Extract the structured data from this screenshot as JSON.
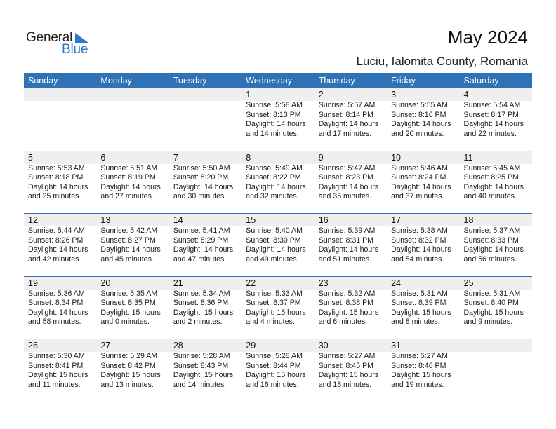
{
  "brand": {
    "word1": "General",
    "word2": "Blue",
    "accent_color": "#2a7bc4"
  },
  "header": {
    "title": "May 2024",
    "location": "Luciu, Ialomita County, Romania"
  },
  "weekdays": [
    "Sunday",
    "Monday",
    "Tuesday",
    "Wednesday",
    "Thursday",
    "Friday",
    "Saturday"
  ],
  "colors": {
    "header_bg": "#2f72b5",
    "date_band": "#efefef"
  },
  "weeks": [
    [
      {
        "day": "",
        "sunrise": "",
        "sunset": "",
        "daylight": "",
        "minutes": ""
      },
      {
        "day": "",
        "sunrise": "",
        "sunset": "",
        "daylight": "",
        "minutes": ""
      },
      {
        "day": "",
        "sunrise": "",
        "sunset": "",
        "daylight": "",
        "minutes": ""
      },
      {
        "day": "1",
        "sunrise": "Sunrise: 5:58 AM",
        "sunset": "Sunset: 8:13 PM",
        "daylight": "Daylight: 14 hours",
        "minutes": "and 14 minutes."
      },
      {
        "day": "2",
        "sunrise": "Sunrise: 5:57 AM",
        "sunset": "Sunset: 8:14 PM",
        "daylight": "Daylight: 14 hours",
        "minutes": "and 17 minutes."
      },
      {
        "day": "3",
        "sunrise": "Sunrise: 5:55 AM",
        "sunset": "Sunset: 8:16 PM",
        "daylight": "Daylight: 14 hours",
        "minutes": "and 20 minutes."
      },
      {
        "day": "4",
        "sunrise": "Sunrise: 5:54 AM",
        "sunset": "Sunset: 8:17 PM",
        "daylight": "Daylight: 14 hours",
        "minutes": "and 22 minutes."
      }
    ],
    [
      {
        "day": "5",
        "sunrise": "Sunrise: 5:53 AM",
        "sunset": "Sunset: 8:18 PM",
        "daylight": "Daylight: 14 hours",
        "minutes": "and 25 minutes."
      },
      {
        "day": "6",
        "sunrise": "Sunrise: 5:51 AM",
        "sunset": "Sunset: 8:19 PM",
        "daylight": "Daylight: 14 hours",
        "minutes": "and 27 minutes."
      },
      {
        "day": "7",
        "sunrise": "Sunrise: 5:50 AM",
        "sunset": "Sunset: 8:20 PM",
        "daylight": "Daylight: 14 hours",
        "minutes": "and 30 minutes."
      },
      {
        "day": "8",
        "sunrise": "Sunrise: 5:49 AM",
        "sunset": "Sunset: 8:22 PM",
        "daylight": "Daylight: 14 hours",
        "minutes": "and 32 minutes."
      },
      {
        "day": "9",
        "sunrise": "Sunrise: 5:47 AM",
        "sunset": "Sunset: 8:23 PM",
        "daylight": "Daylight: 14 hours",
        "minutes": "and 35 minutes."
      },
      {
        "day": "10",
        "sunrise": "Sunrise: 5:46 AM",
        "sunset": "Sunset: 8:24 PM",
        "daylight": "Daylight: 14 hours",
        "minutes": "and 37 minutes."
      },
      {
        "day": "11",
        "sunrise": "Sunrise: 5:45 AM",
        "sunset": "Sunset: 8:25 PM",
        "daylight": "Daylight: 14 hours",
        "minutes": "and 40 minutes."
      }
    ],
    [
      {
        "day": "12",
        "sunrise": "Sunrise: 5:44 AM",
        "sunset": "Sunset: 8:26 PM",
        "daylight": "Daylight: 14 hours",
        "minutes": "and 42 minutes."
      },
      {
        "day": "13",
        "sunrise": "Sunrise: 5:42 AM",
        "sunset": "Sunset: 8:27 PM",
        "daylight": "Daylight: 14 hours",
        "minutes": "and 45 minutes."
      },
      {
        "day": "14",
        "sunrise": "Sunrise: 5:41 AM",
        "sunset": "Sunset: 8:29 PM",
        "daylight": "Daylight: 14 hours",
        "minutes": "and 47 minutes."
      },
      {
        "day": "15",
        "sunrise": "Sunrise: 5:40 AM",
        "sunset": "Sunset: 8:30 PM",
        "daylight": "Daylight: 14 hours",
        "minutes": "and 49 minutes."
      },
      {
        "day": "16",
        "sunrise": "Sunrise: 5:39 AM",
        "sunset": "Sunset: 8:31 PM",
        "daylight": "Daylight: 14 hours",
        "minutes": "and 51 minutes."
      },
      {
        "day": "17",
        "sunrise": "Sunrise: 5:38 AM",
        "sunset": "Sunset: 8:32 PM",
        "daylight": "Daylight: 14 hours",
        "minutes": "and 54 minutes."
      },
      {
        "day": "18",
        "sunrise": "Sunrise: 5:37 AM",
        "sunset": "Sunset: 8:33 PM",
        "daylight": "Daylight: 14 hours",
        "minutes": "and 56 minutes."
      }
    ],
    [
      {
        "day": "19",
        "sunrise": "Sunrise: 5:36 AM",
        "sunset": "Sunset: 8:34 PM",
        "daylight": "Daylight: 14 hours",
        "minutes": "and 58 minutes."
      },
      {
        "day": "20",
        "sunrise": "Sunrise: 5:35 AM",
        "sunset": "Sunset: 8:35 PM",
        "daylight": "Daylight: 15 hours",
        "minutes": "and 0 minutes."
      },
      {
        "day": "21",
        "sunrise": "Sunrise: 5:34 AM",
        "sunset": "Sunset: 8:36 PM",
        "daylight": "Daylight: 15 hours",
        "minutes": "and 2 minutes."
      },
      {
        "day": "22",
        "sunrise": "Sunrise: 5:33 AM",
        "sunset": "Sunset: 8:37 PM",
        "daylight": "Daylight: 15 hours",
        "minutes": "and 4 minutes."
      },
      {
        "day": "23",
        "sunrise": "Sunrise: 5:32 AM",
        "sunset": "Sunset: 8:38 PM",
        "daylight": "Daylight: 15 hours",
        "minutes": "and 6 minutes."
      },
      {
        "day": "24",
        "sunrise": "Sunrise: 5:31 AM",
        "sunset": "Sunset: 8:39 PM",
        "daylight": "Daylight: 15 hours",
        "minutes": "and 8 minutes."
      },
      {
        "day": "25",
        "sunrise": "Sunrise: 5:31 AM",
        "sunset": "Sunset: 8:40 PM",
        "daylight": "Daylight: 15 hours",
        "minutes": "and 9 minutes."
      }
    ],
    [
      {
        "day": "26",
        "sunrise": "Sunrise: 5:30 AM",
        "sunset": "Sunset: 8:41 PM",
        "daylight": "Daylight: 15 hours",
        "minutes": "and 11 minutes."
      },
      {
        "day": "27",
        "sunrise": "Sunrise: 5:29 AM",
        "sunset": "Sunset: 8:42 PM",
        "daylight": "Daylight: 15 hours",
        "minutes": "and 13 minutes."
      },
      {
        "day": "28",
        "sunrise": "Sunrise: 5:28 AM",
        "sunset": "Sunset: 8:43 PM",
        "daylight": "Daylight: 15 hours",
        "minutes": "and 14 minutes."
      },
      {
        "day": "29",
        "sunrise": "Sunrise: 5:28 AM",
        "sunset": "Sunset: 8:44 PM",
        "daylight": "Daylight: 15 hours",
        "minutes": "and 16 minutes."
      },
      {
        "day": "30",
        "sunrise": "Sunrise: 5:27 AM",
        "sunset": "Sunset: 8:45 PM",
        "daylight": "Daylight: 15 hours",
        "minutes": "and 18 minutes."
      },
      {
        "day": "31",
        "sunrise": "Sunrise: 5:27 AM",
        "sunset": "Sunset: 8:46 PM",
        "daylight": "Daylight: 15 hours",
        "minutes": "and 19 minutes."
      },
      {
        "day": "",
        "sunrise": "",
        "sunset": "",
        "daylight": "",
        "minutes": ""
      }
    ]
  ]
}
